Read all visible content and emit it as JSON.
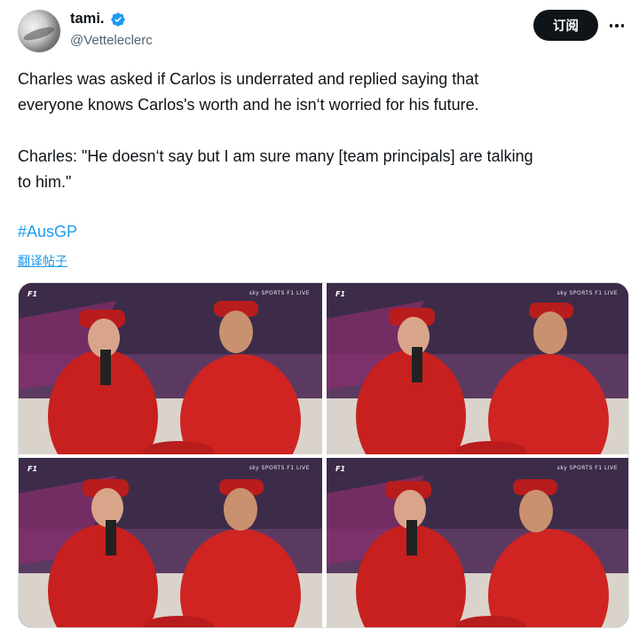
{
  "author": {
    "display_name": "tami.",
    "handle": "@Vetteleclerc",
    "verified": true,
    "avatar_icon": "avatar-image"
  },
  "actions": {
    "subscribe_label": "订阅",
    "more_icon": "more-dots-icon"
  },
  "tweet": {
    "paragraph_1": "Charles was asked if Carlos is underrated and replied saying that\neveryone knows Carlos's worth and he isn‘t worried for his future.",
    "paragraph_2": "Charles: \"He doesn‘t say but I am sure many [team principals] are talking\nto him.\"",
    "hashtag": "#AusGP",
    "translate_link": "翻译帖子"
  },
  "media": {
    "photos": [
      {
        "overlay": "sky SPORTS F1 LIVE"
      },
      {
        "overlay": "sky SPORTS F1 LIVE"
      },
      {
        "overlay": "sky SPORTS F1 LIVE"
      },
      {
        "overlay": "sky SPORTS F1 LIVE"
      }
    ],
    "logo_text": "F1"
  },
  "colors": {
    "accent": "#1d9bf0",
    "text": "#0f1419",
    "muted": "#536471",
    "ferrari_red": "#c8201e"
  }
}
